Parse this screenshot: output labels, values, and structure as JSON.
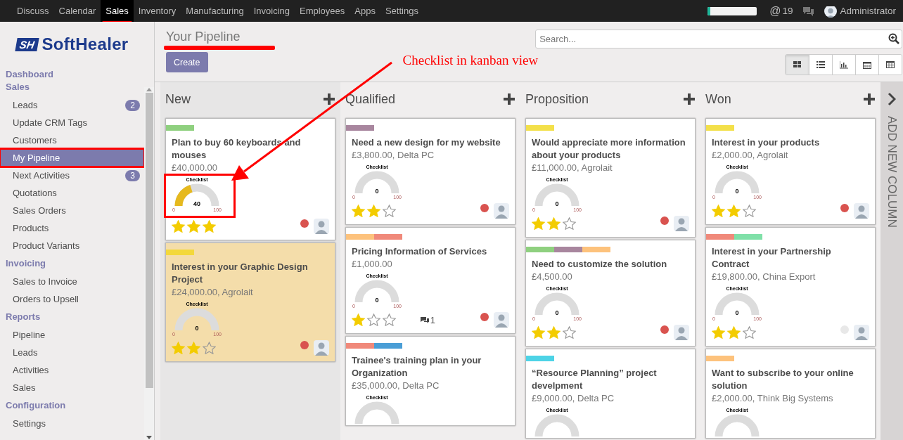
{
  "navbar": {
    "menu": [
      {
        "label": "Discuss",
        "selected": false,
        "annotated": false
      },
      {
        "label": "Calendar",
        "selected": false,
        "annotated": false
      },
      {
        "label": "Sales",
        "selected": true,
        "annotated": true
      },
      {
        "label": "Inventory",
        "selected": false,
        "annotated": false
      },
      {
        "label": "Manufacturing",
        "selected": false,
        "annotated": false
      },
      {
        "label": "Invoicing",
        "selected": false,
        "annotated": false
      },
      {
        "label": "Employees",
        "selected": false,
        "annotated": false
      },
      {
        "label": "Apps",
        "selected": false,
        "annotated": false
      },
      {
        "label": "Settings",
        "selected": false,
        "annotated": false
      }
    ],
    "progress": {
      "level": 0.06
    },
    "mentions": {
      "symbol": "@",
      "count": "19"
    },
    "user": {
      "name": "Administrator"
    }
  },
  "sidebar": {
    "logo": {
      "mark": "SH",
      "name": "SoftHealer"
    },
    "items": [
      {
        "kind": "header",
        "label": "Dashboard"
      },
      {
        "kind": "header",
        "label": "Sales"
      },
      {
        "kind": "item",
        "label": "Leads",
        "badge": "2",
        "selected": false,
        "annotated": false
      },
      {
        "kind": "item",
        "label": "Update CRM Tags",
        "selected": false,
        "annotated": false
      },
      {
        "kind": "item",
        "label": "Customers",
        "selected": false,
        "annotated": false
      },
      {
        "kind": "item",
        "label": "My Pipeline",
        "selected": true,
        "annotated": true
      },
      {
        "kind": "item",
        "label": "Next Activities",
        "badge": "3",
        "selected": false,
        "annotated": false
      },
      {
        "kind": "item",
        "label": "Quotations",
        "selected": false,
        "annotated": false
      },
      {
        "kind": "item",
        "label": "Sales Orders",
        "selected": false,
        "annotated": false
      },
      {
        "kind": "item",
        "label": "Products",
        "selected": false,
        "annotated": false
      },
      {
        "kind": "item",
        "label": "Product Variants",
        "selected": false,
        "annotated": false
      },
      {
        "kind": "header",
        "label": "Invoicing"
      },
      {
        "kind": "item",
        "label": "Sales to Invoice",
        "selected": false,
        "annotated": false
      },
      {
        "kind": "item",
        "label": "Orders to Upsell",
        "selected": false,
        "annotated": false
      },
      {
        "kind": "header",
        "label": "Reports"
      },
      {
        "kind": "item",
        "label": "Pipeline",
        "selected": false,
        "annotated": false
      },
      {
        "kind": "item",
        "label": "Leads",
        "selected": false,
        "annotated": false
      },
      {
        "kind": "item",
        "label": "Activities",
        "selected": false,
        "annotated": false
      },
      {
        "kind": "item",
        "label": "Sales",
        "selected": false,
        "annotated": false
      },
      {
        "kind": "header",
        "label": "Configuration"
      },
      {
        "kind": "item",
        "label": "Settings",
        "selected": false,
        "annotated": false
      }
    ]
  },
  "control_panel": {
    "title": "Your Pipeline",
    "title_annotated": true,
    "create_button": "Create",
    "search": {
      "placeholder": "Search..."
    },
    "views": [
      {
        "kind": "kanban",
        "selected": true
      },
      {
        "kind": "list",
        "selected": false
      },
      {
        "kind": "graph",
        "selected": false
      },
      {
        "kind": "calendar",
        "selected": false
      },
      {
        "kind": "pivot",
        "selected": false
      }
    ]
  },
  "annotation": {
    "text": "Checklist in kanban view"
  },
  "columns": [
    {
      "name": "New",
      "cards": [
        {
          "tags": [
            {
              "color": "#8fd07f"
            }
          ],
          "title": "Plan to buy 60 keyboards and mouses",
          "subtitle": "£40,000.00",
          "color": "#ffffff",
          "gauge": {
            "label": "Checklist",
            "value": "40",
            "level": 0.4,
            "min": "0",
            "max": "100",
            "highlighted": true
          },
          "stars": 3,
          "activity": {
            "color": "#d9534f"
          }
        },
        {
          "tags": [
            {
              "color": "#f3d83b"
            }
          ],
          "title": "Interest in your Graphic Design Project",
          "subtitle": "£24,000.00, Agrolait",
          "color": "#f4ddaa",
          "gauge": {
            "label": "Checklist",
            "value": "0",
            "min": "0",
            "max": "100"
          },
          "stars": 2,
          "activity": {
            "color": "#d9534f"
          }
        }
      ]
    },
    {
      "name": "Qualified",
      "cards": [
        {
          "tags": [
            {
              "color": "#a8869e"
            }
          ],
          "title": "Need a new design for my website",
          "subtitle": "£3,800.00, Delta PC",
          "color": "#ffffff",
          "gauge": {
            "label": "Checklist",
            "value": "0",
            "min": "0",
            "max": "100"
          },
          "stars": 2,
          "activity": {
            "color": "#d9534f"
          }
        },
        {
          "tags": [
            {
              "color": "#fdc27c"
            },
            {
              "color": "#f0897a"
            }
          ],
          "title": "Pricing Information of Services",
          "subtitle": "£1,000.00",
          "color": "#ffffff",
          "gauge": {
            "label": "Checklist",
            "value": "0",
            "min": "0",
            "max": "100"
          },
          "stars": 1,
          "messages": "1",
          "activity": {
            "color": "#d9534f"
          }
        },
        {
          "tags": [
            {
              "color": "#f0897a"
            },
            {
              "color": "#4a9ed6"
            }
          ],
          "title": "Trainee's training plan in your Organization",
          "subtitle": "£35,000.00, Delta PC",
          "color": "#ffffff",
          "gauge": {
            "label": "Checklist"
          }
        }
      ]
    },
    {
      "name": "Proposition",
      "cards": [
        {
          "tags": [
            {
              "color": "#f3e04a"
            }
          ],
          "title": "Would appreciate more information about your products",
          "subtitle": "£11,000.00, Agrolait",
          "color": "#ffffff",
          "gauge": {
            "label": "Checklist",
            "value": "0",
            "min": "0",
            "max": "100"
          },
          "stars": 2,
          "activity": {
            "color": "#d9534f"
          }
        },
        {
          "tags": [
            {
              "color": "#8fd07f"
            },
            {
              "color": "#a8869e"
            },
            {
              "color": "#fdc27c"
            }
          ],
          "title": "Need to customize the solution",
          "subtitle": "£4,500.00",
          "color": "#ffffff",
          "gauge": {
            "label": "Checklist",
            "value": "0",
            "min": "0",
            "max": "100"
          },
          "stars": 2,
          "activity": {
            "color": "#d9534f"
          }
        },
        {
          "tags": [
            {
              "color": "#4dd3e6"
            }
          ],
          "title": "“Resource Planning” project develpment",
          "subtitle": "£9,000.00, Delta PC",
          "color": "#ffffff",
          "gauge": {
            "label": "Checklist"
          }
        }
      ]
    },
    {
      "name": "Won",
      "cards": [
        {
          "tags": [
            {
              "color": "#f3e04a"
            }
          ],
          "title": "Interest in your products",
          "subtitle": "£2,000.00, Agrolait",
          "color": "#ffffff",
          "gauge": {
            "label": "Checklist",
            "value": "0",
            "min": "0",
            "max": "100"
          },
          "stars": 2,
          "activity": {
            "color": "#d9534f"
          }
        },
        {
          "tags": [
            {
              "color": "#f0897a"
            },
            {
              "color": "#7fe0a8"
            }
          ],
          "title": "Interest in your Partnership Contract",
          "subtitle": "£19,800.00, China Export",
          "color": "#ffffff",
          "gauge": {
            "label": "Checklist",
            "value": "0",
            "min": "0",
            "max": "100"
          },
          "stars": 2,
          "activity": {
            "color": "#e8e8e8"
          }
        },
        {
          "tags": [
            {
              "color": "#fdc27c"
            }
          ],
          "title": "Want to subscribe to your online solution",
          "subtitle": "£2,000.00, Think Big Systems",
          "color": "#ffffff",
          "gauge": {
            "label": "Checklist"
          }
        }
      ]
    }
  ],
  "add_column": {
    "label": "ADD NEW COLUMN"
  }
}
